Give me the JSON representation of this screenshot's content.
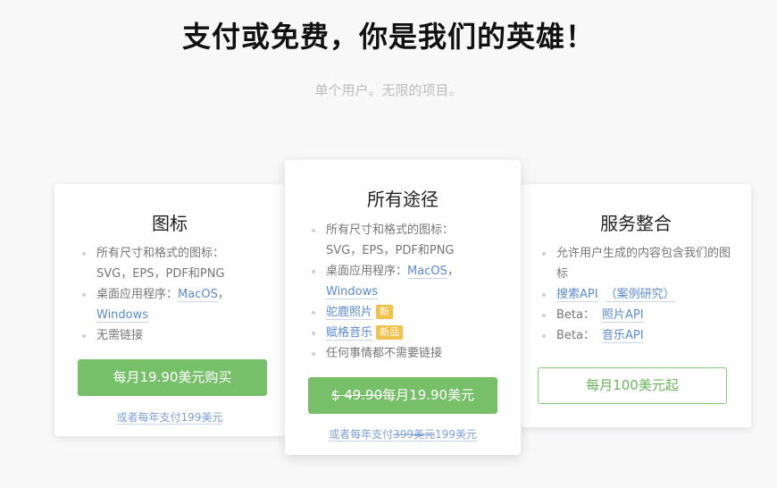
{
  "header": {
    "title": "支付或免费，你是我们的英雄！",
    "subtitle": "单个用户。无限的项目。"
  },
  "plans": [
    {
      "title": "图标",
      "features": {
        "f1_text": "所有尺寸和格式的图标：",
        "f1_formats": "SVG，EPS，PDF和PNG",
        "f2_text": "桌面应用程序：",
        "f2_link_mac": "MacOS",
        "f2_comma": "，",
        "f2_link_win": "Windows",
        "f3_text": "无需链接"
      },
      "button_label": "每月19.90美元购买",
      "sub_link": "或者每年支付199美元"
    },
    {
      "title": "所有途径",
      "features": {
        "f1_text": "所有尺寸和格式的图标：",
        "f1_formats": "SVG，EPS，PDF和PNG",
        "f2_text": "桌面应用程序：",
        "f2_link_mac": "MacOS",
        "f2_comma": "，",
        "f2_link_win": "Windows",
        "f3_link": "驼鹿照片",
        "f3_badge": "新",
        "f4_link": "赋格音乐",
        "f4_badge": "新品",
        "f5_text": "任何事情都不需要链接"
      },
      "button_old_price": "$ 49.90",
      "button_label": "每月19.90美元",
      "sub_link_prefix": "或者每年支付",
      "sub_link_old": "399美元",
      "sub_link_new": "199美元"
    },
    {
      "title": "服务整合",
      "features": {
        "f1_text": "允许用户生成的内容包含我们的图标",
        "f2_link": "搜索API",
        "f2_extra": "（案例研究）",
        "f3_text": "Beta：",
        "f3_link": "照片API",
        "f4_text": "Beta：",
        "f4_link": "音乐API"
      },
      "button_label": "每月100美元起"
    }
  ],
  "colors": {
    "accent_green": "#78bf6a",
    "link_blue": "#5b8bd1",
    "badge_yellow": "#f0c14b"
  }
}
